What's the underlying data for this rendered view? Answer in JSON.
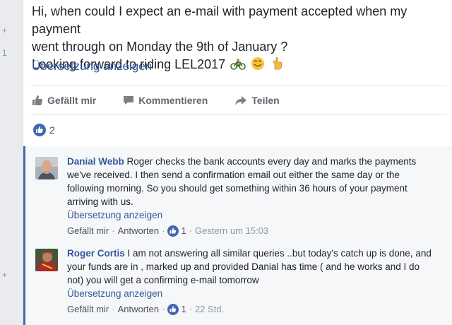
{
  "left_rail": {
    "marks": [
      "+",
      "1",
      "+",
      "+"
    ]
  },
  "post": {
    "lines": [
      "Hi, when could I expect an e-mail with payment accepted when my payment",
      "went through on Monday the 9th of January ?",
      "Looking forward to riding LEL2017"
    ],
    "emojis": [
      "bicycle-icon",
      "smiley-icon",
      "pointing-hand-icon"
    ],
    "translate_label": "Übersetzung anzeigen",
    "actions": {
      "like_label": "Gefällt mir",
      "comment_label": "Kommentieren",
      "share_label": "Teilen"
    },
    "likes_count": "2"
  },
  "comments": [
    {
      "author": "Danial Webb",
      "text": "Roger checks the bank accounts every day and marks the payments we've received. I then send a confirmation email out either the same day or the following morning. So you should get something within 36 hours of your payment arriving with us.",
      "translate_label": "Übersetzung anzeigen",
      "like_label": "Gefällt mir",
      "reply_label": "Antworten",
      "likes": "1",
      "time": "Gestern um 15:03"
    },
    {
      "author": "Roger Cortis",
      "text": "I am not answering all similar queries ..but today's catch up is done, and your funds are in , marked up and provided Danial has time ( and he works and I do not) you will get a confirming e-mail tomorrow",
      "translate_label": "Übersetzung anzeigen",
      "like_label": "Gefällt mir",
      "reply_label": "Antworten",
      "likes": "1",
      "time": "22 Std."
    }
  ],
  "colors": {
    "link": "#365899",
    "like_blue": "#4267b2",
    "muted": "#90949c",
    "rail": "#e9ebee"
  }
}
